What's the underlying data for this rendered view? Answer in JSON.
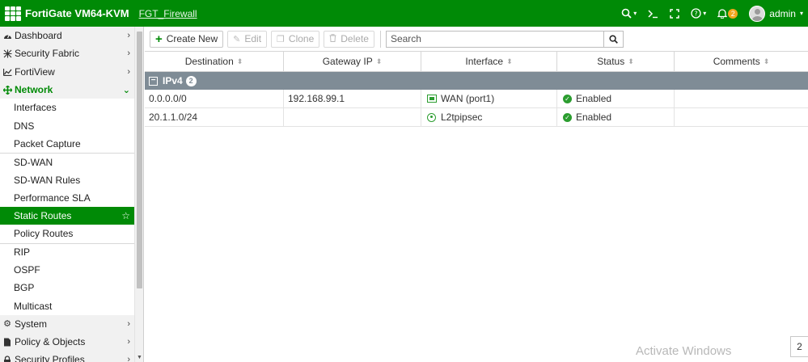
{
  "header": {
    "app_title": "FortiGate VM64-KVM",
    "hostname": "FGT_Firewall",
    "notification_count": "2",
    "user_name": "admin",
    "icons": [
      "search-icon",
      "cli-console-icon",
      "fullscreen-icon",
      "help-icon",
      "bell-icon",
      "user-avatar"
    ]
  },
  "sidebar": {
    "items": [
      {
        "label": "Dashboard",
        "icon": "dashboard-icon"
      },
      {
        "label": "Security Fabric",
        "icon": "security-fabric-icon"
      },
      {
        "label": "FortiView",
        "icon": "fortiview-icon"
      },
      {
        "label": "Network",
        "icon": "network-icon"
      },
      {
        "label": "Interfaces"
      },
      {
        "label": "DNS"
      },
      {
        "label": "Packet Capture"
      },
      {
        "label": "SD-WAN"
      },
      {
        "label": "SD-WAN Rules"
      },
      {
        "label": "Performance SLA"
      },
      {
        "label": "Static Routes"
      },
      {
        "label": "Policy Routes"
      },
      {
        "label": "RIP"
      },
      {
        "label": "OSPF"
      },
      {
        "label": "BGP"
      },
      {
        "label": "Multicast"
      },
      {
        "label": "System",
        "icon": "gear-icon"
      },
      {
        "label": "Policy & Objects",
        "icon": "policy-icon"
      },
      {
        "label": "Security Profiles",
        "icon": "lock-icon"
      }
    ]
  },
  "toolbar": {
    "create_new": "Create New",
    "edit": "Edit",
    "clone": "Clone",
    "delete": "Delete",
    "search_placeholder": "Search"
  },
  "table": {
    "columns": [
      "Destination",
      "Gateway IP",
      "Interface",
      "Status",
      "Comments"
    ],
    "group": {
      "label": "IPv4",
      "count": "2"
    },
    "rows": [
      {
        "destination": "0.0.0.0/0",
        "gateway": "192.168.99.1",
        "interface": "WAN (port1)",
        "interface_icon": "wan-port-icon",
        "status": "Enabled",
        "comments": ""
      },
      {
        "destination": "20.1.1.0/24",
        "gateway": "",
        "interface": "L2tpipsec",
        "interface_icon": "tunnel-icon",
        "status": "Enabled",
        "comments": ""
      }
    ]
  },
  "footer": {
    "watermark": "Activate Windows",
    "corner_count": "2"
  },
  "colors": {
    "brand_green": "#008a06",
    "group_row": "#7f8c96",
    "badge_orange": "#f2a61d"
  }
}
